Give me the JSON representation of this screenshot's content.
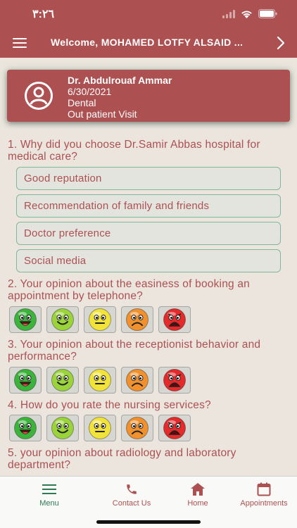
{
  "status_bar": {
    "time": "٣:٢٦",
    "icons": [
      "signal-icon",
      "wifi-icon",
      "battery-icon"
    ]
  },
  "header": {
    "welcome": "Welcome, MOHAMED LOTFY ALSAID ...",
    "menu_icon": "hamburger-icon",
    "next_icon": "chevron-right-icon"
  },
  "visit": {
    "doctor": "Dr. Abdulrouaf Ammar",
    "date": "6/30/2021",
    "department": "Dental",
    "visit_type": "Out patient Visit"
  },
  "questions": [
    {
      "text": "1. Why did you choose Dr.Samir Abbas hospital for medical care?",
      "options": [
        "Good reputation",
        "Recommendation of family and friends",
        "Doctor preference",
        "Social media"
      ]
    },
    {
      "text": "2. Your opinion about the easiness of booking an appointment by telephone?"
    },
    {
      "text": "3. Your opinion about the receptionist behavior and performance?"
    },
    {
      "text": "4. How do you rate the nursing services?"
    },
    {
      "text": "5. your opinion about radiology and laboratory department?"
    }
  ],
  "ratings": [
    {
      "name": "very-happy",
      "color": "#3cb43c"
    },
    {
      "name": "happy",
      "color": "#9bd43a"
    },
    {
      "name": "neutral",
      "color": "#f2e33a"
    },
    {
      "name": "sad",
      "color": "#f0912e"
    },
    {
      "name": "very-sad",
      "color": "#e42a2a"
    }
  ],
  "colors": {
    "primary": "#ad5052",
    "active": "#2f7a55",
    "option_border": "#7fb89a",
    "background": "#ebe5de"
  },
  "nav": [
    {
      "label": "Menu",
      "icon": "menu-icon",
      "active": true
    },
    {
      "label": "Contact Us",
      "icon": "phone-icon",
      "active": false
    },
    {
      "label": "Home",
      "icon": "home-icon",
      "active": false
    },
    {
      "label": "Appointments",
      "icon": "calendar-icon",
      "active": false
    }
  ]
}
